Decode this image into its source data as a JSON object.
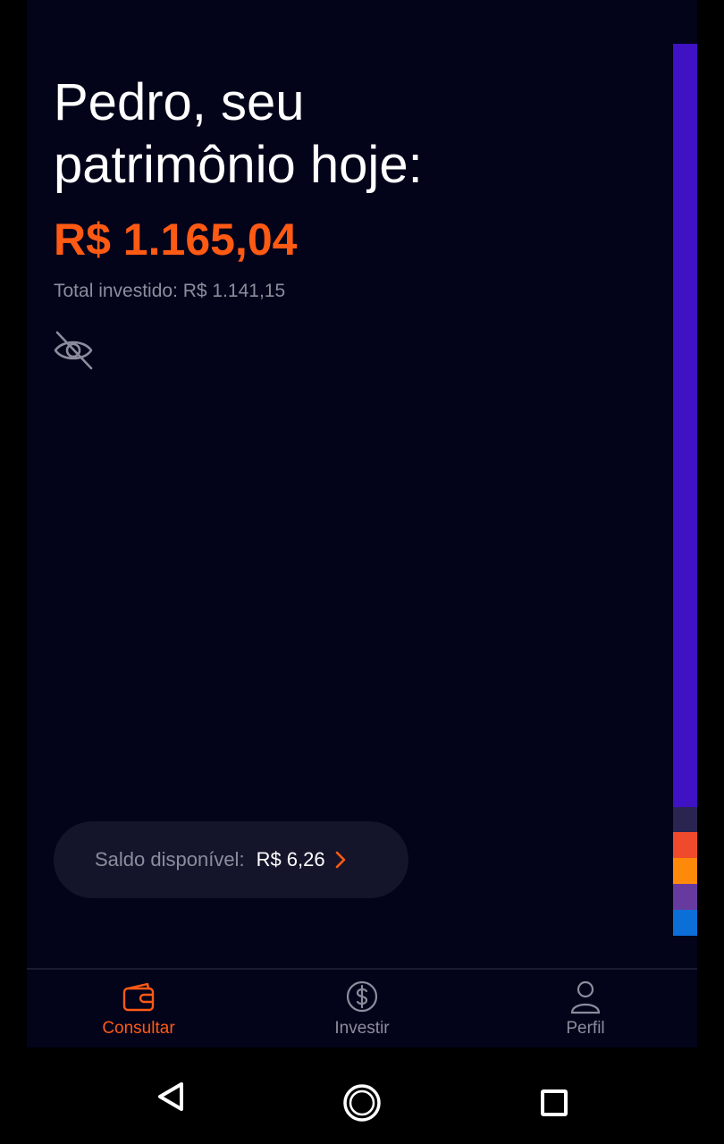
{
  "header": {
    "greeting": "Pedro, seu patrimônio hoje:",
    "total_amount": "R$ 1.165,04",
    "invested_text": "Total investido: R$ 1.141,15"
  },
  "visibility_toggle": {
    "icon": "eye-off-icon"
  },
  "saldo": {
    "label": "Saldo disponível:",
    "value": "R$ 6,26",
    "icon": "chevron-right-icon"
  },
  "allocation_bar": {
    "segments": [
      {
        "share": 0.856,
        "color": "#3f12c4"
      },
      {
        "share": 0.028,
        "color": "#2a2550"
      },
      {
        "share": 0.029,
        "color": "#f04a2c"
      },
      {
        "share": 0.029,
        "color": "#ff8a0a"
      },
      {
        "share": 0.029,
        "color": "#673aa0"
      },
      {
        "share": 0.029,
        "color": "#0c6fd8"
      }
    ]
  },
  "tabs": [
    {
      "label": "Consultar",
      "icon": "wallet-icon",
      "active": true
    },
    {
      "label": "Investir",
      "icon": "dollar-circle-icon",
      "active": false
    },
    {
      "label": "Perfil",
      "icon": "person-icon",
      "active": false
    }
  ],
  "system_nav": {
    "back_icon": "back-triangle-icon",
    "home_icon": "home-circle-icon",
    "recents_icon": "recents-square-icon"
  },
  "colors": {
    "background": "#03031a",
    "accent": "#ff5a14",
    "muted_text": "#8c8d9c",
    "pill_background": "#14152b"
  }
}
